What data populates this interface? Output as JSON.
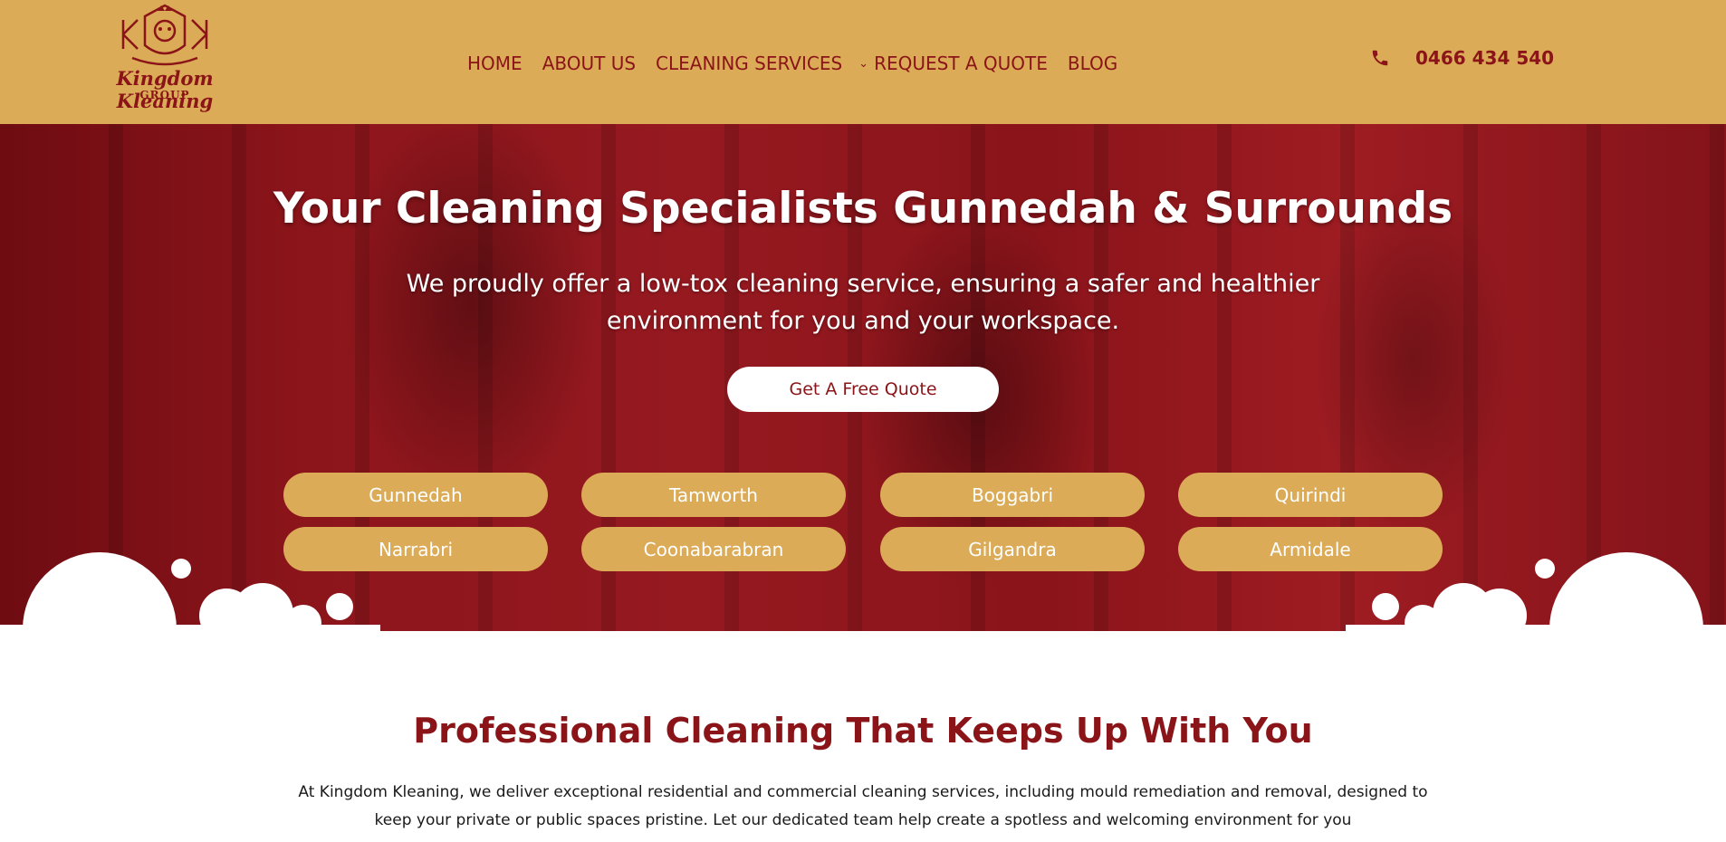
{
  "brand": {
    "name": "Kingdom Kleaning",
    "sub": "GROUP"
  },
  "nav": {
    "items": [
      "HOME",
      "ABOUT US",
      "CLEANING SERVICES",
      "REQUEST A QUOTE",
      "BLOG"
    ]
  },
  "phone": {
    "number": "0466 434 540"
  },
  "hero": {
    "title": "Your Cleaning Specialists Gunnedah & Surrounds",
    "subtitle": "We proudly offer a low-tox cleaning service, ensuring a safer and healthier environment for you and your workspace.",
    "cta": "Get A Free Quote",
    "locations": [
      "Gunnedah",
      "Tamworth",
      "Boggabri",
      "Quirindi",
      "Narrabri",
      "Coonabarabran",
      "Gilgandra",
      "Armidale"
    ]
  },
  "section": {
    "title": "Professional Cleaning That Keeps Up With You",
    "body": "At Kingdom Kleaning, we deliver exceptional residential and commercial cleaning services, including mould remediation and removal, designed to keep your private or public spaces pristine. Let our dedicated team help create a spotless and welcoming environment for you"
  },
  "colors": {
    "gold": "#dbab57",
    "maroon": "#8a1418",
    "white": "#ffffff"
  },
  "icons": {
    "phone": "phone-icon",
    "chevron": "chevron-down-icon",
    "logo": "lion-crown-logo"
  }
}
